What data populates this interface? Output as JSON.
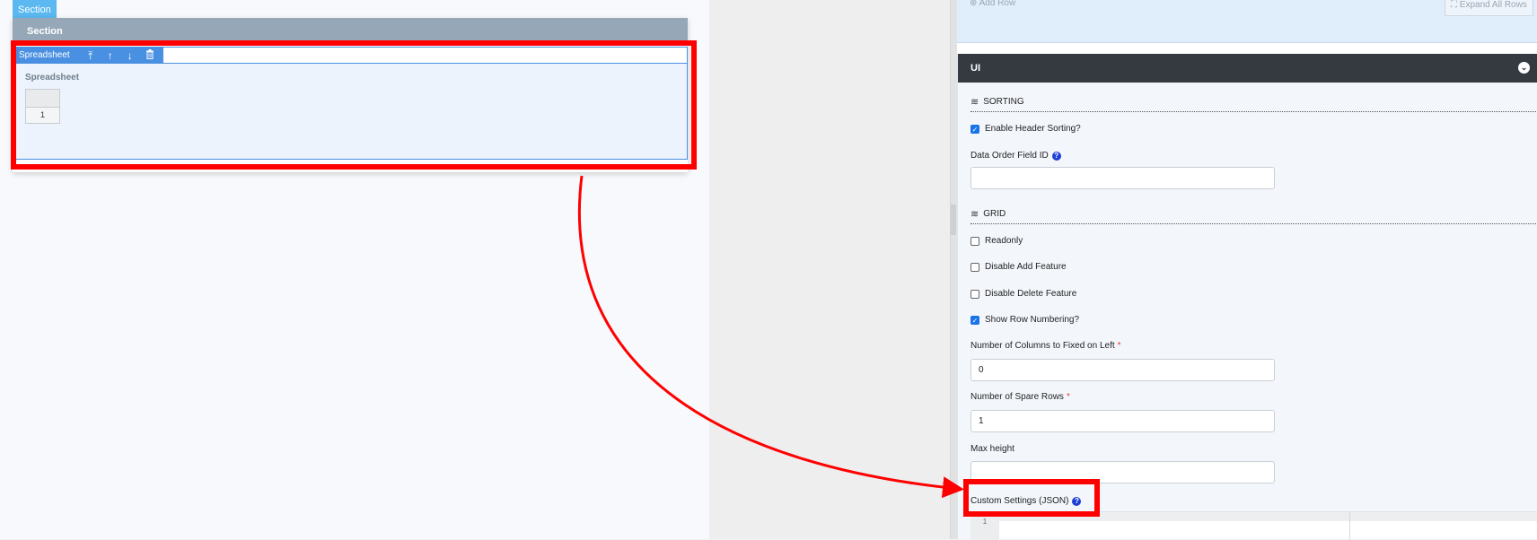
{
  "canvas": {
    "section_tag": "Section",
    "section_header": "Section",
    "spreadsheet": {
      "toolbar_label": "Spreadsheet",
      "toolbar_icons": [
        "move-icon",
        "arrow-up-icon",
        "arrow-down-icon",
        "trash-icon"
      ],
      "title": "Spreadsheet",
      "grid_row_number": "1"
    }
  },
  "top_card": {
    "add_row_label": "Add Row",
    "expand_all_label": "Expand All Rows"
  },
  "ui_panel": {
    "title": "UI",
    "sorting": {
      "title": "SORTING",
      "enable_header_sorting": {
        "label": "Enable Header Sorting?",
        "checked": true
      },
      "data_order_field": {
        "label": "Data Order Field ID",
        "value": ""
      }
    },
    "grid": {
      "title": "GRID",
      "readonly": {
        "label": "Readonly",
        "checked": false
      },
      "disable_add": {
        "label": "Disable Add Feature",
        "checked": false
      },
      "disable_delete": {
        "label": "Disable Delete Feature",
        "checked": false
      },
      "show_row_numbering": {
        "label": "Show Row Numbering?",
        "checked": true
      },
      "fixed_columns": {
        "label": "Number of Columns to Fixed on Left",
        "required": "*",
        "value": "0"
      },
      "spare_rows": {
        "label": "Number of Spare Rows",
        "required": "*",
        "value": "1"
      },
      "max_height": {
        "label": "Max height",
        "value": ""
      },
      "custom_settings": {
        "label": "Custom Settings (JSON)",
        "line_number": "1"
      }
    }
  },
  "annotation": {
    "color": "#ff0000"
  }
}
